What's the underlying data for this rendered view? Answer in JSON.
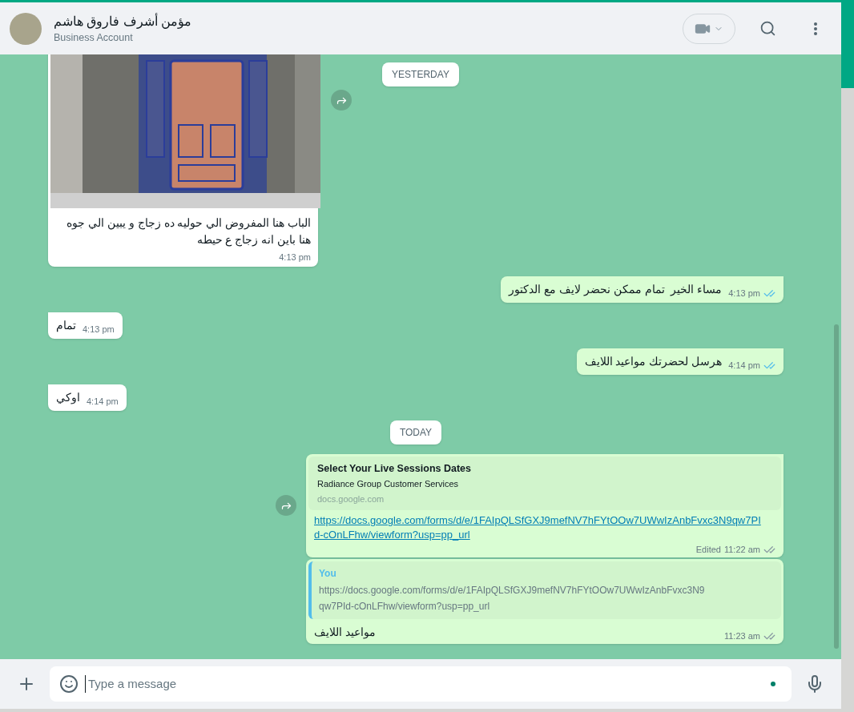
{
  "header": {
    "name": "مؤمن أشرف فاروق هاشم",
    "subtitle": "Business Account"
  },
  "sticky_date": "YESTERDAY",
  "messages": [
    {
      "kind": "image",
      "outgoing": false,
      "caption": "الباب هنا المفروض الي حوليه ده زجاج و يبين الي جوه هنا باين انه زجاج ع حيطه",
      "time": "4:13 pm",
      "forward": true
    },
    {
      "kind": "text",
      "outgoing": true,
      "text": "مساء الخير  تمام ممكن نحضر لايف مع الدكتور",
      "time": "4:13 pm",
      "read": true,
      "forward": false
    },
    {
      "kind": "text",
      "outgoing": false,
      "text": "تمام",
      "time": "4:13 pm",
      "forward": false
    },
    {
      "kind": "text",
      "outgoing": true,
      "text": "هرسل لحضرتك مواعيد اللايف",
      "time": "4:14 pm",
      "read": true,
      "forward": false
    },
    {
      "kind": "text",
      "outgoing": false,
      "text": "اوكي",
      "time": "4:14 pm",
      "forward": false
    },
    {
      "kind": "date",
      "label": "TODAY"
    },
    {
      "kind": "link",
      "outgoing": true,
      "preview": {
        "title": "Select Your Live Sessions Dates",
        "description": "Radiance Group Customer Services",
        "domain": "docs.google.com"
      },
      "url": "https://docs.google.com/forms/d/e/1FAIpQLSfGXJ9mefNV7hFYtOOw7UWwIzAnbFvxc3N9qw7PId-cOnLFhw/viewform?usp=pp_url",
      "edited": "Edited",
      "time": "11:22 am",
      "read": false,
      "forward": true
    },
    {
      "kind": "reply",
      "outgoing": true,
      "quote": {
        "author": "You",
        "text": "https://docs.google.com/forms/d/e/1FAIpQLSfGXJ9mefNV7hFYtOOw7UWwIzAnbFvxc3N9qw7PId-cOnLFhw/viewform?usp=pp_url"
      },
      "text": "مواعيد اللايف",
      "time": "11:23 am",
      "read": false,
      "forward": false
    }
  ],
  "composer": {
    "placeholder": "Type a message"
  }
}
